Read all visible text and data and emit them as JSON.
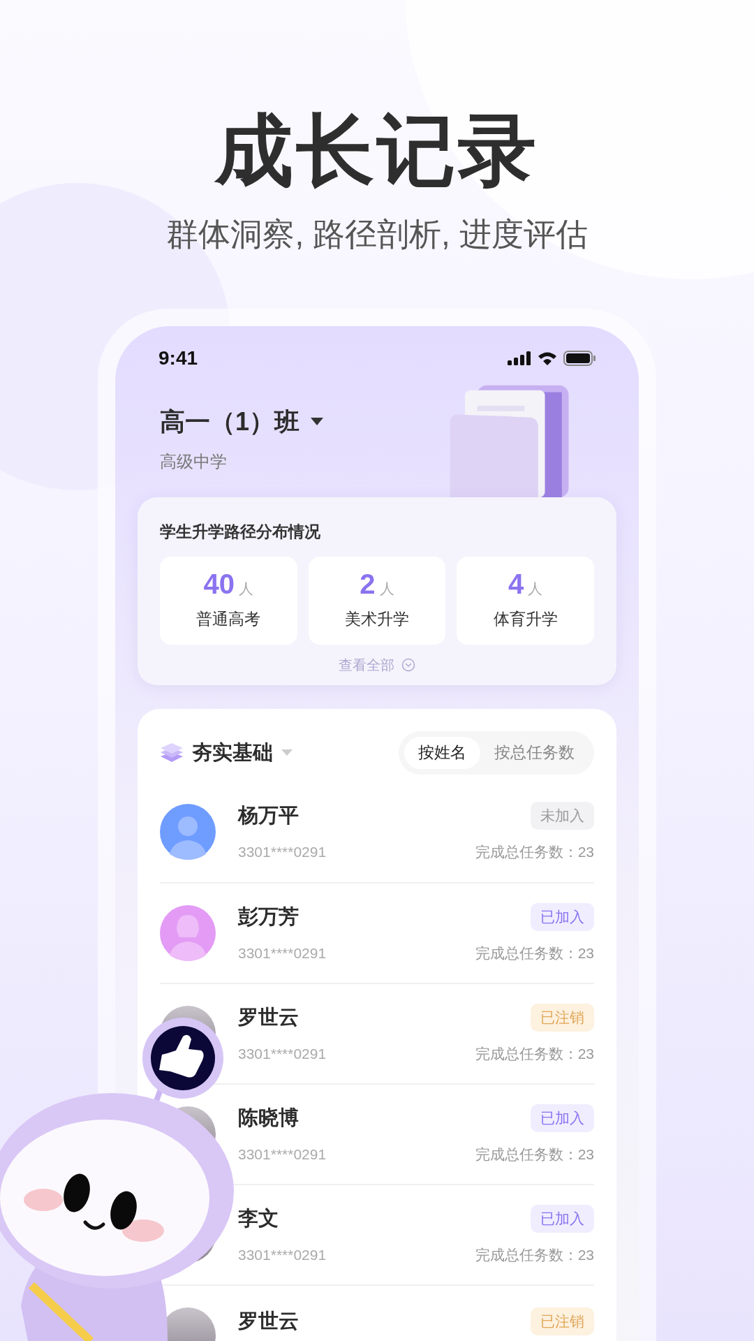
{
  "hero": {
    "title": "成长记录",
    "subtitle": "群体洞察, 路径剖析, 进度评估"
  },
  "status_bar": {
    "time": "9:41"
  },
  "header": {
    "class_name": "高一（1）班",
    "school": "高级中学"
  },
  "path_card": {
    "title": "学生升学路径分布情况",
    "stats": [
      {
        "value": "40",
        "unit": "人",
        "label": "普通高考"
      },
      {
        "value": "2",
        "unit": "人",
        "label": "美术升学"
      },
      {
        "value": "4",
        "unit": "人",
        "label": "体育升学"
      }
    ],
    "more": "查看全部"
  },
  "list": {
    "category": "夯实基础",
    "sort_tabs": [
      {
        "label": "按姓名",
        "selected": true
      },
      {
        "label": "按总任务数",
        "selected": false
      }
    ],
    "students": [
      {
        "name": "杨万平",
        "id": "3301****0291",
        "badge": {
          "text": "未加入",
          "kind": "not_joined"
        },
        "tasks": "完成总任务数：23",
        "avatar": {
          "kind": "male"
        }
      },
      {
        "name": "彭万芳",
        "id": "3301****0291",
        "badge": {
          "text": "已加入",
          "kind": "joined"
        },
        "tasks": "完成总任务数：23",
        "avatar": {
          "kind": "female"
        }
      },
      {
        "name": "罗世云",
        "id": "3301****0291",
        "badge": {
          "text": "已注销",
          "kind": "cancelled"
        },
        "tasks": "完成总任务数：23",
        "avatar": {
          "kind": "photo"
        }
      },
      {
        "name": "陈晓博",
        "id": "3301****0291",
        "badge": {
          "text": "已加入",
          "kind": "joined"
        },
        "tasks": "完成总任务数：23",
        "avatar": {
          "kind": "photo"
        }
      },
      {
        "name": "李文",
        "id": "3301****0291",
        "badge": {
          "text": "已加入",
          "kind": "joined"
        },
        "tasks": "完成总任务数：23",
        "avatar": {
          "kind": "photo"
        }
      },
      {
        "name": "罗世云",
        "badge": {
          "text": "已注销",
          "kind": "cancelled"
        },
        "avatar": {
          "kind": "photo"
        }
      }
    ]
  }
}
